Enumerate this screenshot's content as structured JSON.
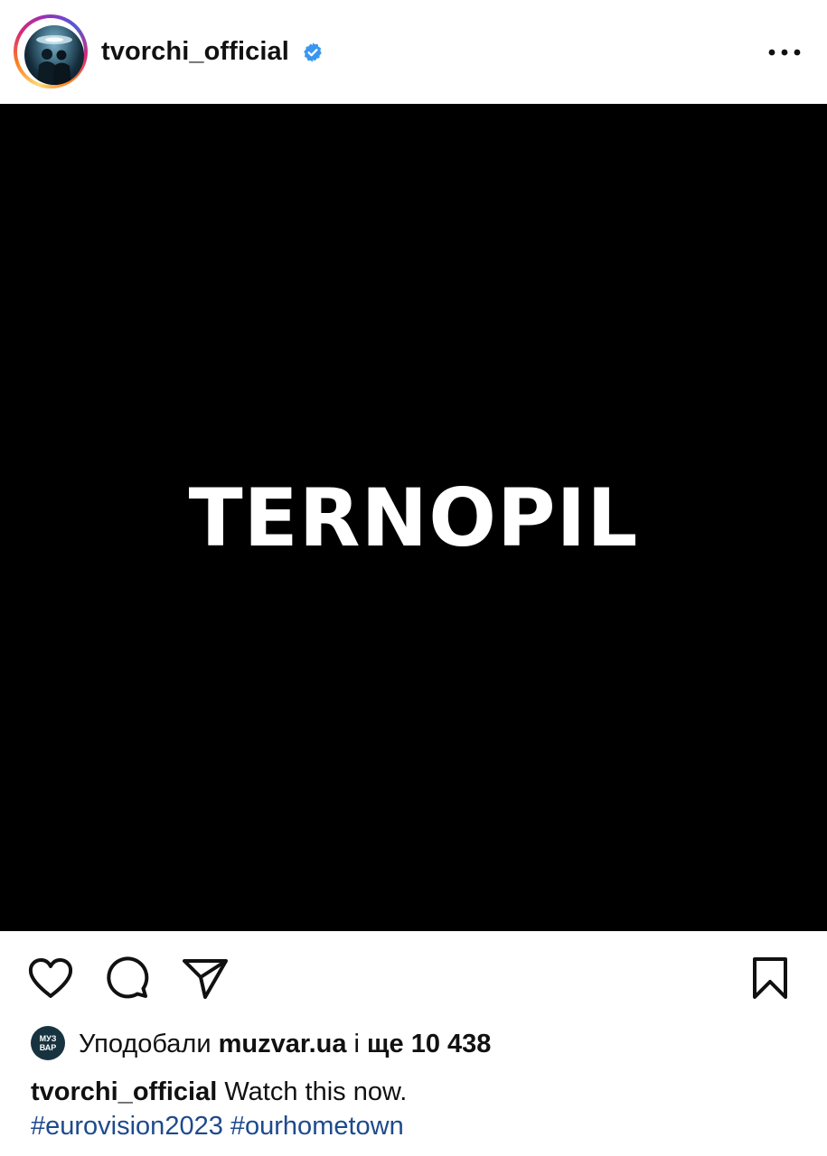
{
  "header": {
    "username": "tvorchi_official",
    "verified": true,
    "avatar_icon": "profile-photo",
    "more_icon": "more-options-icon"
  },
  "media": {
    "text": "TERNOPIL",
    "background_color": "#000000",
    "text_color": "#ffffff"
  },
  "actions": {
    "like_icon": "heart-icon",
    "comment_icon": "comment-icon",
    "share_icon": "send-icon",
    "save_icon": "bookmark-icon"
  },
  "likes": {
    "avatar_line1": "МУЗ",
    "avatar_line2": "ВАР",
    "prefix": "Уподобали",
    "liked_by": "muzvar.ua",
    "conjunction": "і",
    "others": "ще 10 438"
  },
  "caption": {
    "author": "tvorchi_official",
    "text": "Watch this now.",
    "hashtags": [
      "#eurovision2023",
      "#ourhometown"
    ]
  },
  "colors": {
    "verified_blue": "#3897f0",
    "hashtag_blue": "#1e4a8c"
  }
}
